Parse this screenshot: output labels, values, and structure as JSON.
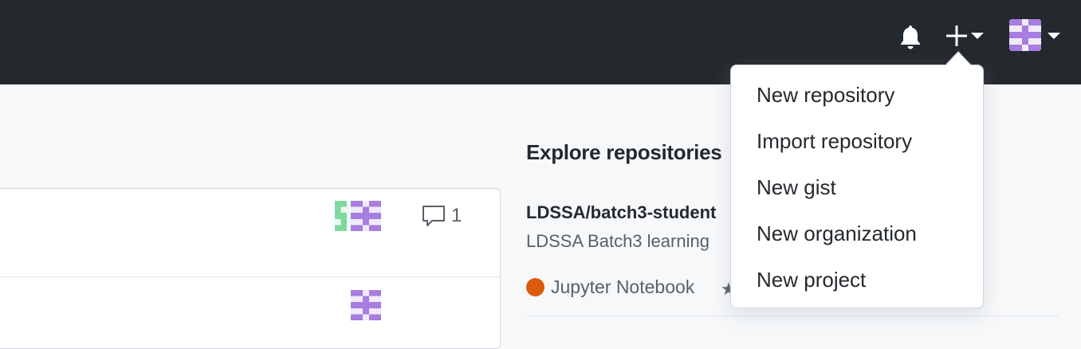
{
  "header": {
    "notifications_icon": "bell-icon",
    "create_icon": "plus-icon",
    "profile_icon": "identicon-avatar"
  },
  "feed": {
    "items": [
      {
        "avatars": [
          "identicon-green",
          "identicon-purple"
        ],
        "comment_count": "1"
      },
      {
        "avatars": [
          "identicon-purple"
        ]
      }
    ]
  },
  "explore": {
    "title": "Explore repositories",
    "repos": [
      {
        "name": "LDSSA/batch3-student",
        "description": "LDSSA Batch3 learning",
        "language": "Jupyter Notebook",
        "language_color": "#DA5B0B"
      }
    ]
  },
  "create_menu": {
    "items": [
      "New repository",
      "Import repository",
      "New gist",
      "New organization",
      "New project"
    ]
  },
  "colors": {
    "header_bg": "#24292e",
    "page_bg": "#f6f8fa",
    "identicon_purple": "#a77de0",
    "identicon_green": "#7fd8a0"
  }
}
